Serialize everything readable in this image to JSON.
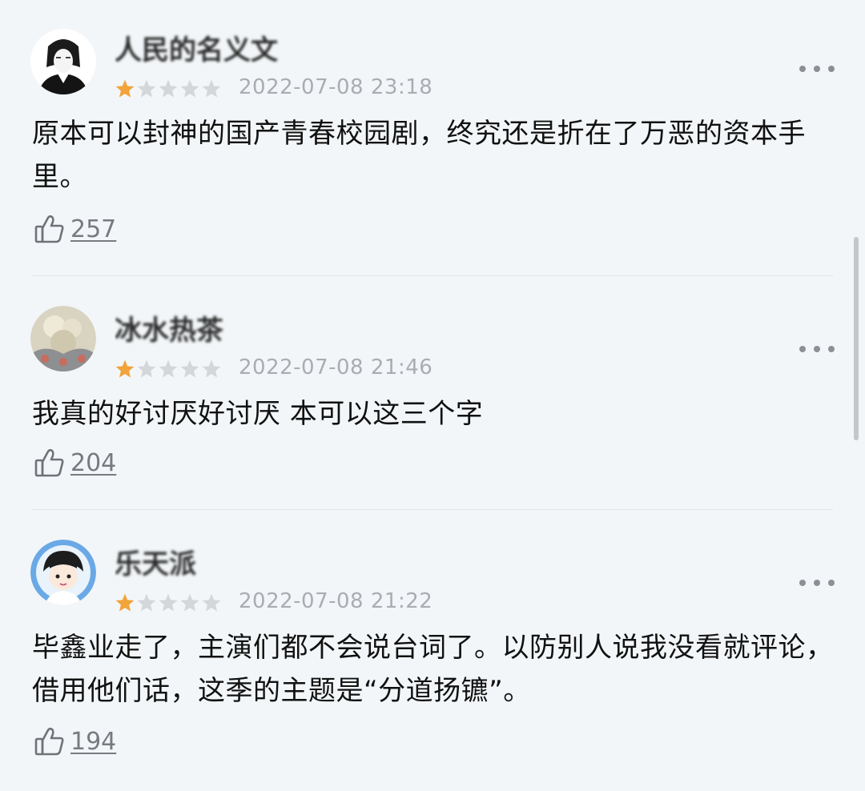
{
  "reviews": [
    {
      "username": "人民的名义文",
      "rating": 1,
      "max_rating": 5,
      "timestamp": "2022-07-08 23:18",
      "content": "原本可以封神的国产青春校园剧，终究还是折在了万恶的资本手里。",
      "likes": "257"
    },
    {
      "username": "冰水热茶",
      "rating": 1,
      "max_rating": 5,
      "timestamp": "2022-07-08 21:46",
      "content": "我真的好讨厌好讨厌 本可以这三个字",
      "likes": "204"
    },
    {
      "username": "乐天派",
      "rating": 1,
      "max_rating": 5,
      "timestamp": "2022-07-08 21:22",
      "content": "毕鑫业走了，主演们都不会说台词了。以防别人说我没看就评论，借用他们话，这季的主题是“分道扬镳”。",
      "likes": "194"
    }
  ],
  "colors": {
    "star_filled": "#f2a33a",
    "star_empty": "#d4d6d9",
    "background": "#f3f6f8"
  },
  "icons": {
    "like": "thumbs-up-icon",
    "more": "more-dots-icon"
  }
}
